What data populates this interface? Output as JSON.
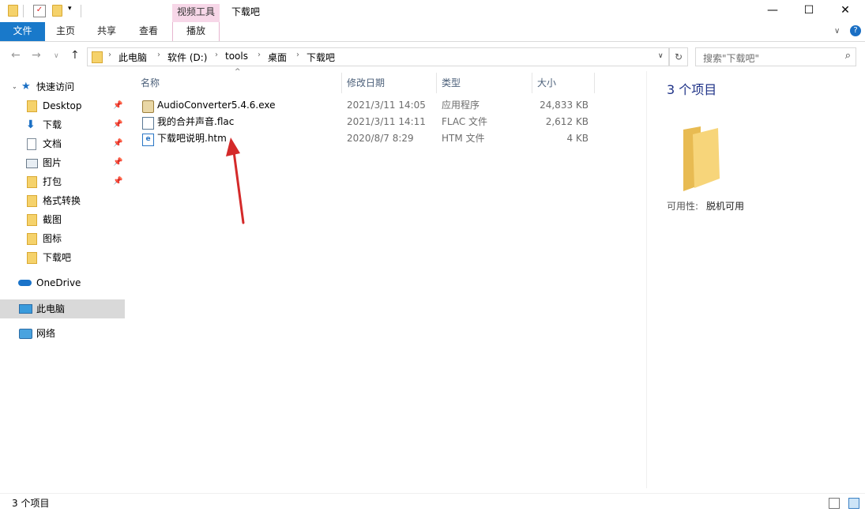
{
  "window": {
    "context_tab": "视频工具",
    "title": "下载吧",
    "minimize": "—",
    "maximize": "☐",
    "close": "✕"
  },
  "ribbon": {
    "tabs": [
      "文件",
      "主页",
      "共享",
      "查看",
      "播放"
    ],
    "expand": "∨",
    "help": "?"
  },
  "address": {
    "back": "←",
    "forward": "→",
    "recent": "∨",
    "up": "↑",
    "crumbs": [
      "此电脑",
      "软件 (D:)",
      "tools",
      "桌面",
      "下载吧"
    ],
    "dropdown": "∨",
    "refresh": "↻"
  },
  "search": {
    "placeholder": "搜索\"下载吧\"",
    "icon": "search-icon"
  },
  "sidebar": {
    "quick_access": "快速访问",
    "items": [
      {
        "label": "Desktop",
        "pinned": true,
        "icon": "folder-icon"
      },
      {
        "label": "下载",
        "pinned": true,
        "icon": "download-arrow-icon"
      },
      {
        "label": "文档",
        "pinned": true,
        "icon": "document-icon"
      },
      {
        "label": "图片",
        "pinned": true,
        "icon": "picture-icon"
      },
      {
        "label": "打包",
        "pinned": true,
        "icon": "folder-icon"
      },
      {
        "label": "格式转换",
        "pinned": false,
        "icon": "folder-icon"
      },
      {
        "label": "截图",
        "pinned": false,
        "icon": "folder-icon"
      },
      {
        "label": "图标",
        "pinned": false,
        "icon": "folder-icon"
      },
      {
        "label": "下载吧",
        "pinned": false,
        "icon": "folder-icon"
      }
    ],
    "onedrive": "OneDrive",
    "this_pc": "此电脑",
    "network": "网络"
  },
  "columns": {
    "name": "名称",
    "date": "修改日期",
    "type": "类型",
    "size": "大小"
  },
  "files": [
    {
      "name": "AudioConverter5.4.6.exe",
      "date": "2021/3/11 14:05",
      "type": "应用程序",
      "size": "24,833 KB",
      "icon": "installer-icon"
    },
    {
      "name": "我的合并声音.flac",
      "date": "2021/3/11 14:11",
      "type": "FLAC 文件",
      "size": "2,612 KB",
      "icon": "audio-file-icon"
    },
    {
      "name": "下载吧说明.htm",
      "date": "2020/8/7 8:29",
      "type": "HTM 文件",
      "size": "4 KB",
      "icon": "edge-html-icon"
    }
  ],
  "details": {
    "count": "3 个项目",
    "availability_label": "可用性:",
    "availability_value": "脱机可用"
  },
  "status": {
    "text": "3 个项目"
  },
  "watermark": "下载吧",
  "colors": {
    "file_tab": "#1979ca",
    "context_tab": "#f7d7e8",
    "selection": "#d9d9d9",
    "annotation_arrow": "#d42a2a"
  }
}
